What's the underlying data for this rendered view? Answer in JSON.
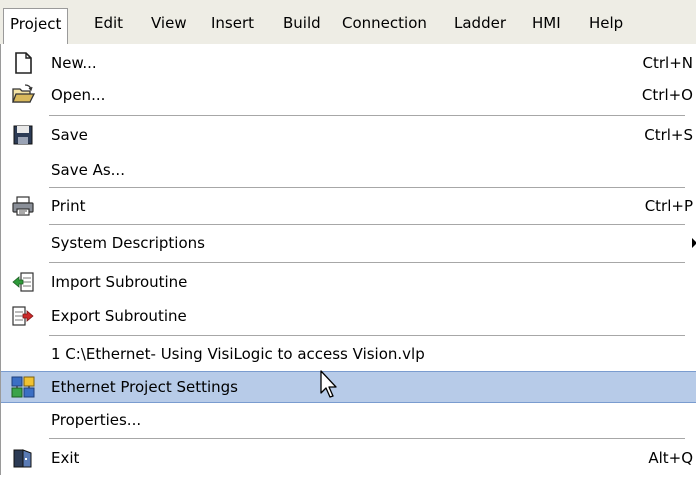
{
  "menubar": {
    "items": [
      {
        "label": "Project"
      },
      {
        "label": "Edit"
      },
      {
        "label": "View"
      },
      {
        "label": "Insert"
      },
      {
        "label": "Build"
      },
      {
        "label": "Connection"
      },
      {
        "label": "Ladder"
      },
      {
        "label": "HMI"
      },
      {
        "label": "Help"
      }
    ]
  },
  "dropdown": {
    "items": [
      {
        "label": "New...",
        "shortcut": "Ctrl+N",
        "icon": "new-document-icon"
      },
      {
        "label": "Open...",
        "shortcut": "Ctrl+O",
        "icon": "open-folder-icon"
      },
      {
        "label": "Save",
        "shortcut": "Ctrl+S",
        "icon": "floppy-disk-icon"
      },
      {
        "label": "Save As...",
        "shortcut": ""
      },
      {
        "label": "Print",
        "shortcut": "Ctrl+P",
        "icon": "printer-icon"
      },
      {
        "label": "System Descriptions",
        "shortcut": "",
        "submenu": true
      },
      {
        "label": "Import Subroutine",
        "shortcut": "",
        "icon": "import-subroutine-icon"
      },
      {
        "label": "Export Subroutine",
        "shortcut": "",
        "icon": "export-subroutine-icon"
      },
      {
        "label": "1 C:\\Ethernet- Using VisiLogic to access Vision.vlp",
        "shortcut": ""
      },
      {
        "label": "Ethernet Project Settings",
        "shortcut": "",
        "icon": "ethernet-settings-icon",
        "highlighted": true
      },
      {
        "label": "Properties...",
        "shortcut": ""
      },
      {
        "label": "Exit",
        "shortcut": "Alt+Q",
        "icon": "exit-door-icon"
      }
    ]
  },
  "colors": {
    "menubar_bg": "#eeede5",
    "highlight_bg": "#b7cbe8",
    "highlight_border": "#7a9ccf"
  }
}
